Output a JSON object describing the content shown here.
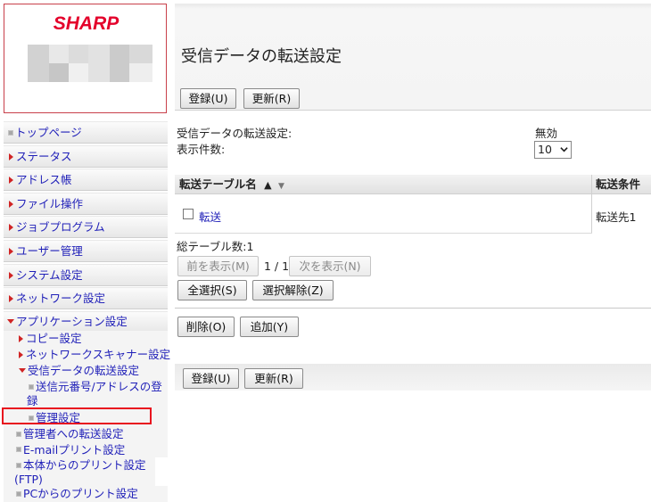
{
  "brand": {
    "logo_text": "SHARP"
  },
  "nav": {
    "items": [
      {
        "label": "トップページ",
        "marker": "bullet"
      },
      {
        "label": "ステータス",
        "marker": "triangle"
      },
      {
        "label": "アドレス帳",
        "marker": "triangle"
      },
      {
        "label": "ファイル操作",
        "marker": "triangle"
      },
      {
        "label": "ジョブプログラム",
        "marker": "triangle"
      },
      {
        "label": "ユーザー管理",
        "marker": "triangle"
      },
      {
        "label": "システム設定",
        "marker": "triangle"
      },
      {
        "label": "ネットワーク設定",
        "marker": "triangle"
      }
    ],
    "app_settings": {
      "label": "アプリケーション設定",
      "copy": "コピー設定",
      "network_scanner": "ネットワークスキャナー設定",
      "inbound_routing": "受信データの転送設定",
      "sender_registration": "送信元番号/アドレスの登録",
      "admin_settings": "管理設定",
      "admin_forward": "管理者への転送設定",
      "email_print": "E-mailプリント設定",
      "ftp_print": "本体からのプリント設定 (FTP)",
      "pc_print": "PCからのプリント設定"
    }
  },
  "page": {
    "title": "受信データの転送設定",
    "register_button": "登録(U)",
    "update_button": "更新(R)",
    "setting_label": "受信データの転送設定:",
    "setting_value": "無効",
    "display_count_label": "表示件数:",
    "display_count_value": "10"
  },
  "table": {
    "col_name": "転送テーブル名",
    "col_condition": "転送条件",
    "sort_asc": "▲",
    "sort_desc": "▼",
    "rows": [
      {
        "name": "転送",
        "condition": "転送先1"
      }
    ],
    "total_tables": "総テーブル数:1",
    "prev_button": "前を表示(M)",
    "page_indicator": "1 / 1",
    "next_button": "次を表示(N)",
    "select_all_button": "全選択(S)",
    "deselect_button": "選択解除(Z)",
    "delete_button": "削除(O)",
    "add_button": "追加(Y)"
  },
  "colors": {
    "brand_red": "#e4002b",
    "link_blue": "#1f1fb8",
    "highlight_red": "#e8121e",
    "nav_marker_red": "#d02424"
  }
}
